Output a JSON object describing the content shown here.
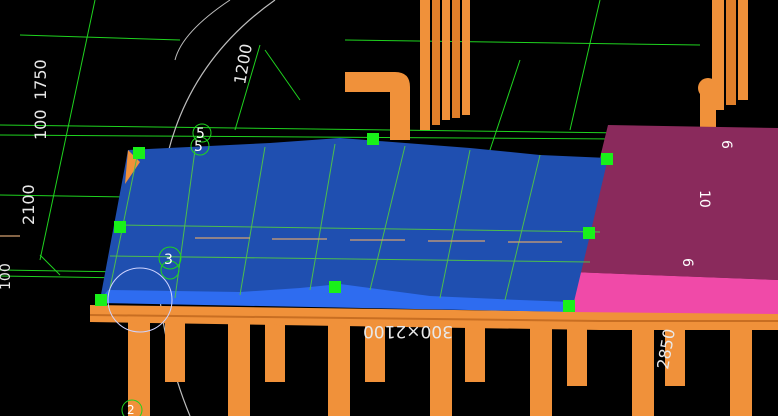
{
  "viewport": {
    "background": "#000000",
    "colors": {
      "slab_top": "#1f4fb0",
      "slab_front": "#2e6cf0",
      "slab_shadow": "#133a8c",
      "pipe": "#f0913a",
      "pipe_dark": "#c86e22",
      "magenta_top": "#8a2a5c",
      "magenta_front": "#f04aa8",
      "grid_line": "#1fd31f",
      "grip": "#19f019",
      "dim_text": "#e8e8e8",
      "highlight_outline": "#cfd3ff"
    }
  },
  "dimensions": {
    "vertical_1750": "1750",
    "vertical_100_a": "100",
    "vertical_1200": "1200",
    "vertical_2100": "2100",
    "vertical_100_b": "100",
    "beam_size": "300×2100",
    "height_2850": "2850"
  },
  "magenta_labels": {
    "top": "6",
    "middle": "10",
    "bottom": "6"
  },
  "markers": {
    "marker_5a": "5",
    "marker_5b": "5",
    "marker_3": "3",
    "marker_2": "2"
  }
}
